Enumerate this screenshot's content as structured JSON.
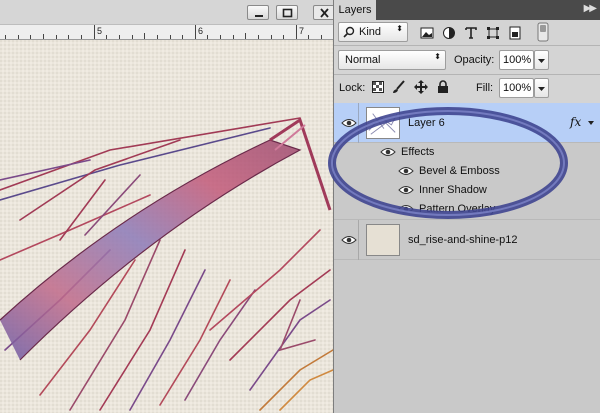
{
  "window": {
    "minimize_icon": "minimize-icon",
    "maximize_icon": "maximize-icon",
    "close_icon": "close-icon"
  },
  "ruler": {
    "labels": [
      "5",
      "6",
      "7"
    ]
  },
  "panel": {
    "tab_label": "Layers",
    "menu_icon": "double-chevron-icon",
    "filter": {
      "search_icon": "search-icon",
      "kind_label": "Kind",
      "icons": [
        "image-filter-icon",
        "adjustment-filter-icon",
        "type-filter-icon",
        "shape-filter-icon",
        "smart-object-filter-icon",
        "filter-toggle-icon"
      ]
    },
    "blend_mode": "Normal",
    "opacity_label": "Opacity:",
    "opacity_value": "100%",
    "lock_label": "Lock:",
    "lock_icons": [
      "lock-transparency-icon",
      "lock-brush-icon",
      "lock-move-icon",
      "lock-all-icon"
    ],
    "fill_label": "Fill:",
    "fill_value": "100%"
  },
  "layers": {
    "layer6": {
      "name": "Layer 6",
      "fx_label": "fx",
      "effects_label": "Effects",
      "effects": [
        "Bevel & Emboss",
        "Inner Shadow",
        "Pattern Overlay"
      ]
    },
    "background": {
      "name": "sd_rise-and-shine-p12"
    }
  },
  "colors": {
    "selected_row": "#b7cff7",
    "annotation_oval": "#4a4f9a",
    "panel_bg": "#d4d4d4"
  }
}
